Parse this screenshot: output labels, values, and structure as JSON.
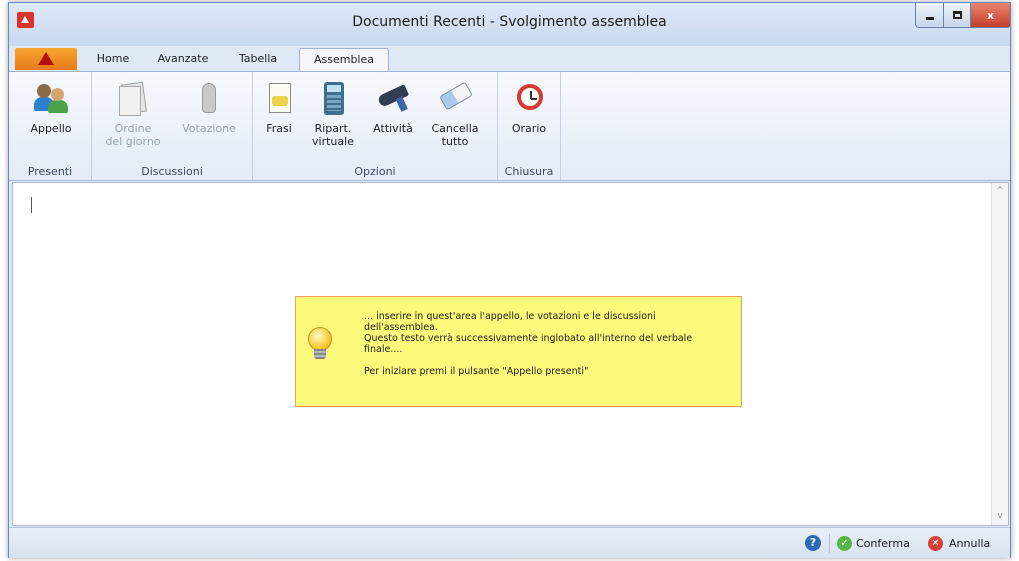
{
  "window": {
    "title": "Documenti Recenti - Svolgimento assemblea",
    "controls": {
      "minimize_icon": "minimize-icon",
      "maximize_icon": "maximize-icon",
      "close_label": "x"
    }
  },
  "tabs": {
    "file_tab_icon": "app-logo-icon",
    "items": [
      "Home",
      "Avanzate",
      "Tabella",
      "Assemblea"
    ],
    "active": "Assemblea"
  },
  "ribbon": {
    "groups": [
      {
        "label": "Presenti",
        "buttons": [
          {
            "label": "Appello",
            "icon": "people-icon",
            "enabled": true
          }
        ]
      },
      {
        "label": "Discussioni",
        "buttons": [
          {
            "label": "Ordine",
            "label2": "del giorno",
            "icon": "document-icon",
            "enabled": false
          },
          {
            "label": "Votazione",
            "icon": "hand-icon",
            "enabled": false
          }
        ]
      },
      {
        "label": "Opzioni",
        "buttons": [
          {
            "label": "Frasi",
            "icon": "phrases-document-icon",
            "enabled": true
          },
          {
            "label": "Ripart.",
            "label2": "virtuale",
            "icon": "calculator-icon",
            "enabled": true
          },
          {
            "label": "Attività",
            "icon": "drill-icon",
            "enabled": true
          },
          {
            "label": "Cancella",
            "label2": "tutto",
            "icon": "eraser-icon",
            "enabled": true
          }
        ]
      },
      {
        "label": "Chiusura",
        "buttons": [
          {
            "label": "Orario",
            "icon": "alarm-clock-icon",
            "enabled": true
          }
        ]
      }
    ]
  },
  "editor": {
    "hint": {
      "icon": "lightbulb-icon",
      "line1": "... inserire in quest'area l'appello, le votazioni e le discussioni",
      "line2": "dell'assemblea.",
      "line3": "Questo testo verrà successivamente inglobato all'interno del verbale",
      "line4": "finale....",
      "line5": "Per iniziare premi il pulsante \"Appello presenti\""
    },
    "scroll_up": "^",
    "scroll_down": "v"
  },
  "statusbar": {
    "help_label": "?",
    "confirm_label": "Conferma",
    "cancel_label": "Annulla",
    "confirm_mark": "✓",
    "cancel_mark": "✕"
  }
}
